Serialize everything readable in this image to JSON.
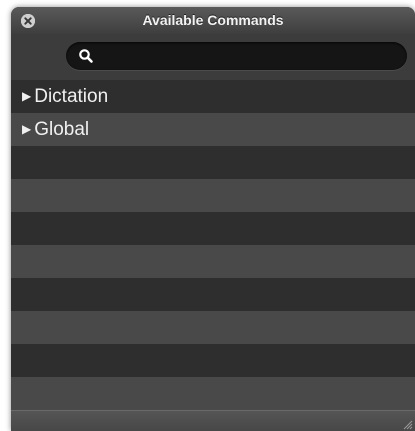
{
  "window": {
    "title": "Available Commands"
  },
  "search": {
    "value": "",
    "placeholder": ""
  },
  "list": {
    "items": [
      {
        "label": "Dictation",
        "expander": "▶"
      },
      {
        "label": "Global",
        "expander": "▶"
      }
    ]
  },
  "icons": {
    "close": "close-icon",
    "search": "search-icon",
    "disclosure": "disclosure-triangle-icon",
    "resize": "resize-grip-icon"
  }
}
